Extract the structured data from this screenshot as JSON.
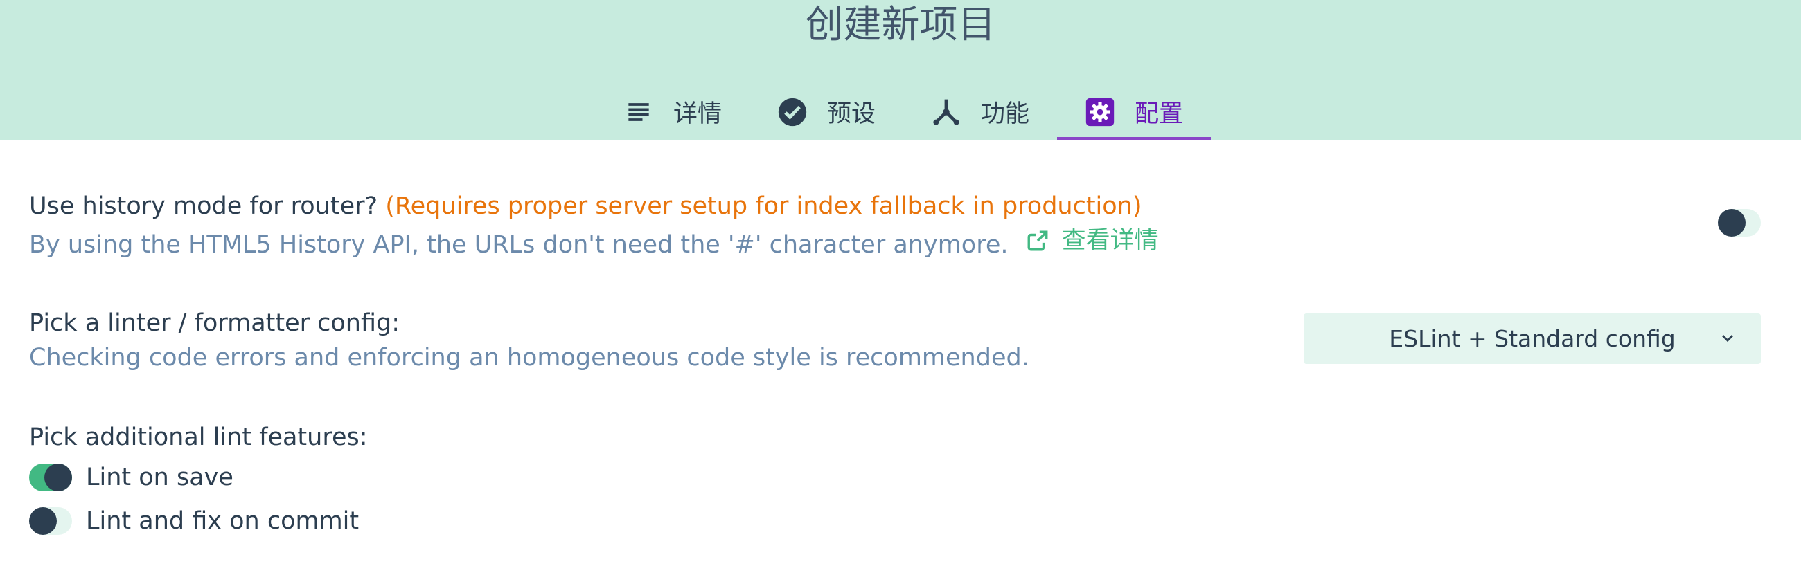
{
  "header": {
    "title": "创建新项目"
  },
  "tabs": [
    {
      "label": "详情",
      "icon": "list-icon",
      "active": false
    },
    {
      "label": "预设",
      "icon": "check-circle-icon",
      "active": false
    },
    {
      "label": "功能",
      "icon": "fork-icon",
      "active": false
    },
    {
      "label": "配置",
      "icon": "gear-icon",
      "active": true
    }
  ],
  "router": {
    "label": "Use history mode for router?",
    "warning": "(Requires proper server setup for index fallback in production)",
    "description": "By using the HTML5 History API, the URLs don't need the '#' character anymore.",
    "link_label": "查看详情",
    "enabled": false
  },
  "linter": {
    "label": "Pick a linter / formatter config:",
    "description": "Checking code errors and enforcing an homogeneous code style is recommended.",
    "selected": "ESLint + Standard config"
  },
  "lint_features": {
    "label": "Pick additional lint features:",
    "options": [
      {
        "label": "Lint on save",
        "checked": true
      },
      {
        "label": "Lint and fix on commit",
        "checked": false
      }
    ]
  },
  "colors": {
    "accent": "#42b983",
    "header_bg": "#c7ebde",
    "active_tab": "#6a1bb8",
    "warning": "#e8740b"
  }
}
